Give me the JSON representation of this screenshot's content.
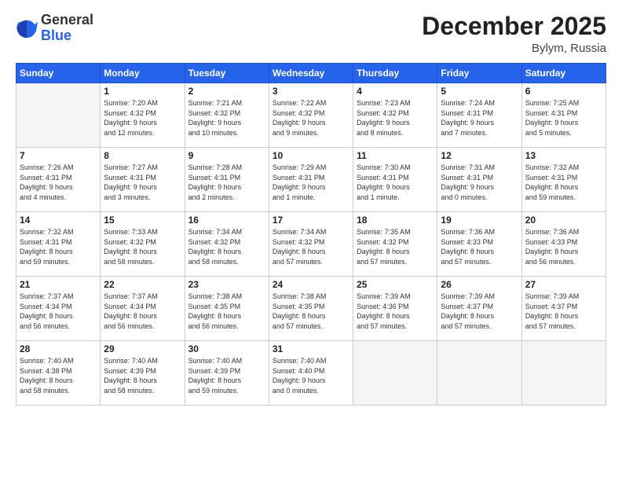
{
  "logo": {
    "general": "General",
    "blue": "Blue"
  },
  "title": "December 2025",
  "location": "Bylym, Russia",
  "days_of_week": [
    "Sunday",
    "Monday",
    "Tuesday",
    "Wednesday",
    "Thursday",
    "Friday",
    "Saturday"
  ],
  "weeks": [
    [
      {
        "day": "",
        "info": ""
      },
      {
        "day": "1",
        "info": "Sunrise: 7:20 AM\nSunset: 4:32 PM\nDaylight: 9 hours\nand 12 minutes."
      },
      {
        "day": "2",
        "info": "Sunrise: 7:21 AM\nSunset: 4:32 PM\nDaylight: 9 hours\nand 10 minutes."
      },
      {
        "day": "3",
        "info": "Sunrise: 7:22 AM\nSunset: 4:32 PM\nDaylight: 9 hours\nand 9 minutes."
      },
      {
        "day": "4",
        "info": "Sunrise: 7:23 AM\nSunset: 4:32 PM\nDaylight: 9 hours\nand 8 minutes."
      },
      {
        "day": "5",
        "info": "Sunrise: 7:24 AM\nSunset: 4:31 PM\nDaylight: 9 hours\nand 7 minutes."
      },
      {
        "day": "6",
        "info": "Sunrise: 7:25 AM\nSunset: 4:31 PM\nDaylight: 9 hours\nand 5 minutes."
      }
    ],
    [
      {
        "day": "7",
        "info": "Sunrise: 7:26 AM\nSunset: 4:31 PM\nDaylight: 9 hours\nand 4 minutes."
      },
      {
        "day": "8",
        "info": "Sunrise: 7:27 AM\nSunset: 4:31 PM\nDaylight: 9 hours\nand 3 minutes."
      },
      {
        "day": "9",
        "info": "Sunrise: 7:28 AM\nSunset: 4:31 PM\nDaylight: 9 hours\nand 2 minutes."
      },
      {
        "day": "10",
        "info": "Sunrise: 7:29 AM\nSunset: 4:31 PM\nDaylight: 9 hours\nand 1 minute."
      },
      {
        "day": "11",
        "info": "Sunrise: 7:30 AM\nSunset: 4:31 PM\nDaylight: 9 hours\nand 1 minute."
      },
      {
        "day": "12",
        "info": "Sunrise: 7:31 AM\nSunset: 4:31 PM\nDaylight: 9 hours\nand 0 minutes."
      },
      {
        "day": "13",
        "info": "Sunrise: 7:32 AM\nSunset: 4:31 PM\nDaylight: 8 hours\nand 59 minutes."
      }
    ],
    [
      {
        "day": "14",
        "info": "Sunrise: 7:32 AM\nSunset: 4:31 PM\nDaylight: 8 hours\nand 59 minutes."
      },
      {
        "day": "15",
        "info": "Sunrise: 7:33 AM\nSunset: 4:32 PM\nDaylight: 8 hours\nand 58 minutes."
      },
      {
        "day": "16",
        "info": "Sunrise: 7:34 AM\nSunset: 4:32 PM\nDaylight: 8 hours\nand 58 minutes."
      },
      {
        "day": "17",
        "info": "Sunrise: 7:34 AM\nSunset: 4:32 PM\nDaylight: 8 hours\nand 57 minutes."
      },
      {
        "day": "18",
        "info": "Sunrise: 7:35 AM\nSunset: 4:32 PM\nDaylight: 8 hours\nand 57 minutes."
      },
      {
        "day": "19",
        "info": "Sunrise: 7:36 AM\nSunset: 4:33 PM\nDaylight: 8 hours\nand 57 minutes."
      },
      {
        "day": "20",
        "info": "Sunrise: 7:36 AM\nSunset: 4:33 PM\nDaylight: 8 hours\nand 56 minutes."
      }
    ],
    [
      {
        "day": "21",
        "info": "Sunrise: 7:37 AM\nSunset: 4:34 PM\nDaylight: 8 hours\nand 56 minutes."
      },
      {
        "day": "22",
        "info": "Sunrise: 7:37 AM\nSunset: 4:34 PM\nDaylight: 8 hours\nand 56 minutes."
      },
      {
        "day": "23",
        "info": "Sunrise: 7:38 AM\nSunset: 4:35 PM\nDaylight: 8 hours\nand 56 minutes."
      },
      {
        "day": "24",
        "info": "Sunrise: 7:38 AM\nSunset: 4:35 PM\nDaylight: 8 hours\nand 57 minutes."
      },
      {
        "day": "25",
        "info": "Sunrise: 7:39 AM\nSunset: 4:36 PM\nDaylight: 8 hours\nand 57 minutes."
      },
      {
        "day": "26",
        "info": "Sunrise: 7:39 AM\nSunset: 4:37 PM\nDaylight: 8 hours\nand 57 minutes."
      },
      {
        "day": "27",
        "info": "Sunrise: 7:39 AM\nSunset: 4:37 PM\nDaylight: 8 hours\nand 57 minutes."
      }
    ],
    [
      {
        "day": "28",
        "info": "Sunrise: 7:40 AM\nSunset: 4:38 PM\nDaylight: 8 hours\nand 58 minutes."
      },
      {
        "day": "29",
        "info": "Sunrise: 7:40 AM\nSunset: 4:39 PM\nDaylight: 8 hours\nand 58 minutes."
      },
      {
        "day": "30",
        "info": "Sunrise: 7:40 AM\nSunset: 4:39 PM\nDaylight: 8 hours\nand 59 minutes."
      },
      {
        "day": "31",
        "info": "Sunrise: 7:40 AM\nSunset: 4:40 PM\nDaylight: 9 hours\nand 0 minutes."
      },
      {
        "day": "",
        "info": ""
      },
      {
        "day": "",
        "info": ""
      },
      {
        "day": "",
        "info": ""
      }
    ]
  ]
}
